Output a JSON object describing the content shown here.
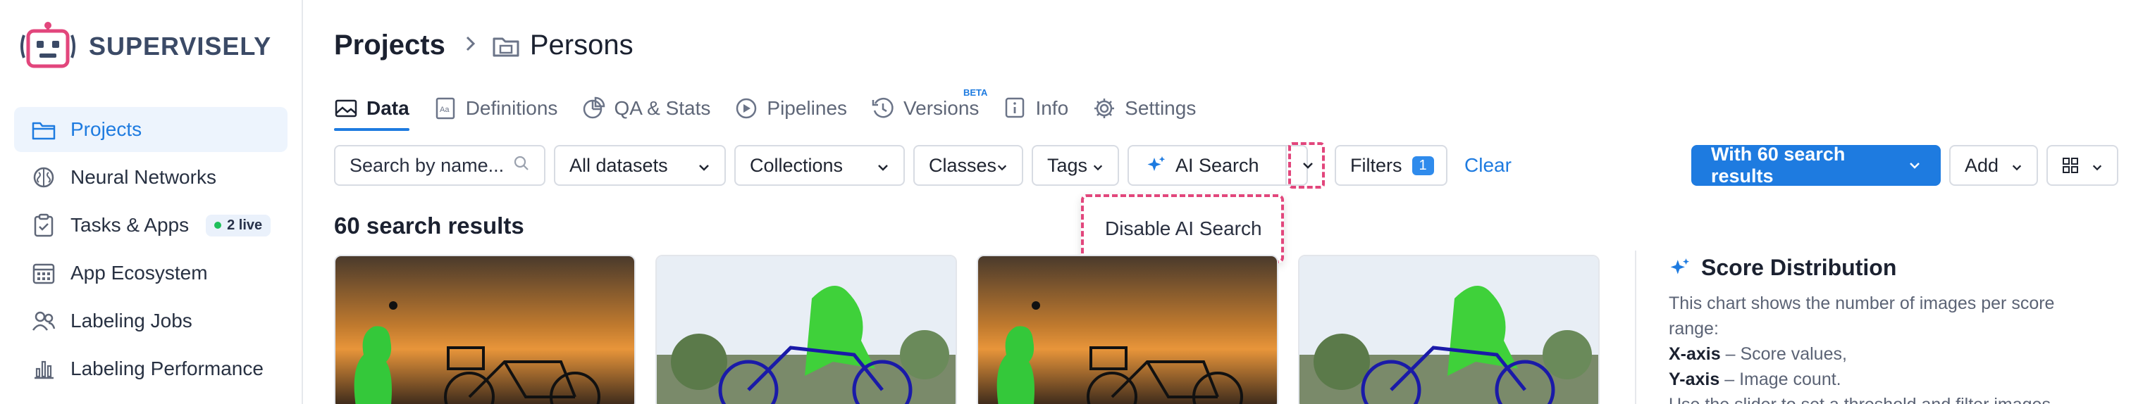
{
  "brand": {
    "name": "SUPERVISELY"
  },
  "sidebar": {
    "items": [
      {
        "label": "Projects",
        "icon": "folder-icon",
        "active": true
      },
      {
        "label": "Neural Networks",
        "icon": "brain-icon"
      },
      {
        "label": "Tasks & Apps",
        "icon": "clipboard-icon",
        "badge": "2 live"
      },
      {
        "label": "App Ecosystem",
        "icon": "grid-calendar-icon"
      },
      {
        "label": "Labeling Jobs",
        "icon": "users-icon"
      },
      {
        "label": "Labeling Performance",
        "icon": "bar-chart-icon"
      }
    ]
  },
  "breadcrumb": {
    "root": "Projects",
    "separator": ">",
    "current": "Persons"
  },
  "tabs": [
    {
      "label": "Data",
      "active": true
    },
    {
      "label": "Definitions"
    },
    {
      "label": "QA & Stats"
    },
    {
      "label": "Pipelines"
    },
    {
      "label": "Versions",
      "tag": "BETA"
    },
    {
      "label": "Info"
    },
    {
      "label": "Settings"
    }
  ],
  "toolbar": {
    "search_placeholder": "Search by name...",
    "datasets": "All datasets",
    "collections": "Collections",
    "classes": "Classes",
    "tags": "Tags",
    "ai_search": "AI Search",
    "filters": "Filters",
    "filters_count": "1",
    "clear": "Clear",
    "results_button": "With 60 search results",
    "add": "Add"
  },
  "dropdown": {
    "item": "Disable AI Search"
  },
  "results": {
    "title": "60 search results"
  },
  "score_panel": {
    "title": "Score Distribution",
    "desc_intro": "This chart shows the number of images per score range:",
    "x_key": "X-axis",
    "x_text": " – Score values,",
    "y_key": "Y-axis",
    "y_text": " – Image count.",
    "slider_text": "Use the slider to set a threshold and filter images."
  },
  "colors": {
    "accent": "#1e7be0",
    "highlight": "#e2467c",
    "brand": "#e2467c"
  }
}
